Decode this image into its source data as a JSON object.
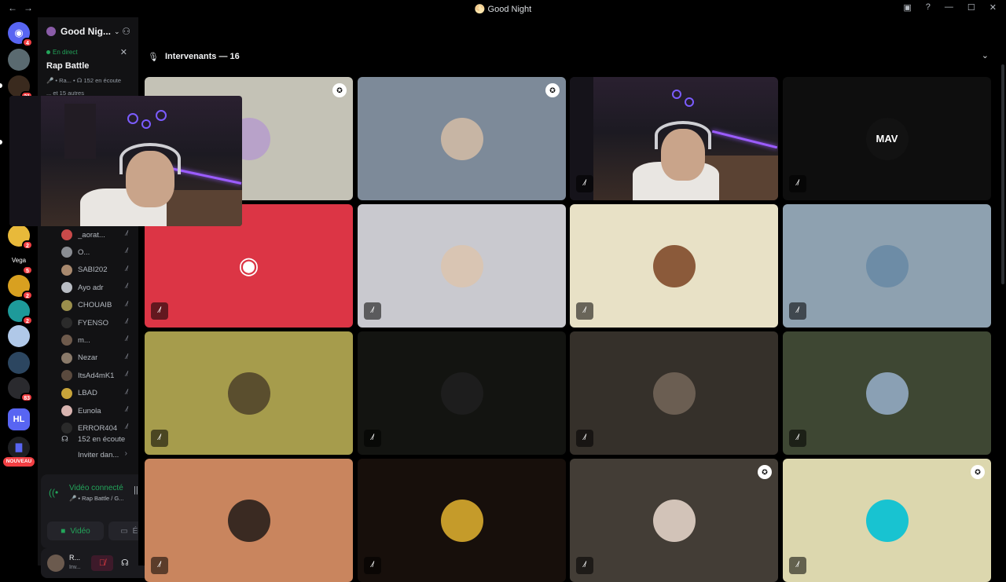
{
  "window": {
    "title": "Good Night",
    "nav_back": "←",
    "nav_fwd": "→"
  },
  "server": {
    "name": "Good Nig...",
    "chevron": "⌄"
  },
  "stage": {
    "live_label": "En direct",
    "name": "Rap Battle",
    "sub": "🎤 • Ra... • ☊ 152 en écoute",
    "sub2": "... et 15 autres"
  },
  "guild_badges": [
    "4",
    "21",
    "2",
    "5",
    "2",
    "2",
    "83"
  ],
  "guild_labels": {
    "vega": "Vega",
    "new": "NOUVEAU",
    "hl": "HL"
  },
  "members": [
    {
      "name": "_aorat...",
      "color": "#c94a4a"
    },
    {
      "name": "O...",
      "color": "#8a8d93"
    },
    {
      "name": "SABI202",
      "color": "#a8896e"
    },
    {
      "name": "Ayo adr",
      "color": "#b9bdc4"
    },
    {
      "name": "CHOUAIB",
      "color": "#9b8f4c"
    },
    {
      "name": "FYENSO",
      "color": "#2b2b2b"
    },
    {
      "name": "m...",
      "color": "#6e5a4c"
    },
    {
      "name": "Nezar",
      "color": "#8a7a6a"
    },
    {
      "name": "ItsAd4mK1",
      "color": "#5a4a3e"
    },
    {
      "name": "LBAD",
      "color": "#c8a43a"
    },
    {
      "name": "Eunola",
      "color": "#d8b4b0"
    },
    {
      "name": "ERROR404",
      "color": "#2a2a2a"
    }
  ],
  "listeners": "152 en écoute",
  "invite": "Inviter dan...",
  "voice": {
    "title": "Vidéo connecté",
    "sub": "🎤 • Rap Battle / G...",
    "video_label": "Vidéo",
    "screen_label": "Écran"
  },
  "user": {
    "name": "R...",
    "status": "Inv..."
  },
  "main": {
    "header": "Intervenants — 16"
  },
  "tiles": [
    {
      "bg": "#c4c2b6",
      "av": "#b8a2c9",
      "mod": true,
      "mute": false
    },
    {
      "bg": "#7d8a99",
      "av": "#c7b5a4",
      "mod": true,
      "mute": false
    },
    {
      "bg": "camera",
      "av": "",
      "mod": false,
      "mute": true
    },
    {
      "bg": "#0e0e0e",
      "av": "#121212",
      "mod": false,
      "mute": true,
      "text": "MAV"
    },
    {
      "bg": "#dc3545",
      "av": "discord",
      "mod": false,
      "mute": true
    },
    {
      "bg": "#c9c9cf",
      "av": "#d9c5b3",
      "mod": false,
      "mute": true
    },
    {
      "bg": "#e8e1c6",
      "av": "#8b5a3a",
      "mod": false,
      "mute": true
    },
    {
      "bg": "#8ea1b0",
      "av": "#6d8ca6",
      "mod": false,
      "mute": true
    },
    {
      "bg": "#a69c4c",
      "av": "#5a4e2e",
      "mod": false,
      "mute": true
    },
    {
      "bg": "#131411",
      "av": "#1d1d1d",
      "mod": false,
      "mute": true
    },
    {
      "bg": "#35302a",
      "av": "#6b5e52",
      "mod": false,
      "mute": true
    },
    {
      "bg": "#3e4733",
      "av": "#8aa0b4",
      "mod": false,
      "mute": true
    },
    {
      "bg": "#c9855e",
      "av": "#3a2a22",
      "mod": false,
      "mute": true
    },
    {
      "bg": "#170f0b",
      "av": "#c59b2a",
      "mod": false,
      "mute": true
    },
    {
      "bg": "#433d36",
      "av": "#d2c3b8",
      "mod": true,
      "mute": true
    },
    {
      "bg": "#dcd7ae",
      "av": "#18c3d1",
      "mod": true,
      "mute": true
    }
  ],
  "colors": {
    "accent": "#5865f2",
    "green": "#23a55a",
    "red": "#f23f43",
    "sidebar": "#121214"
  }
}
